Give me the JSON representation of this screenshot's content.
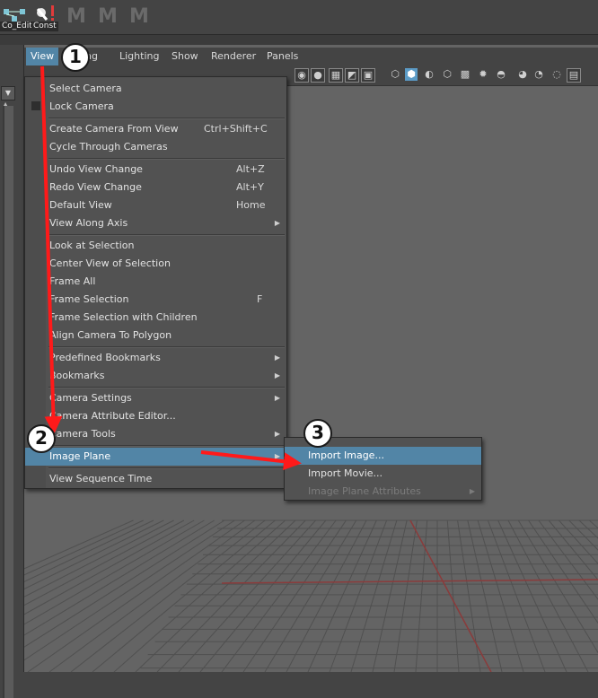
{
  "shelf": {
    "items": [
      {
        "label": "Co_Edit",
        "icon": "node-graph-icon"
      },
      {
        "label": "Const",
        "icon": "constraint-icon"
      }
    ],
    "m_icons": [
      "M",
      "M",
      "M"
    ]
  },
  "panel_menubar": {
    "items": [
      "View",
      "Shading",
      "Lighting",
      "Show",
      "Renderer",
      "Panels"
    ],
    "visible_labels": [
      "View",
      "ing",
      "Lighting",
      "Show",
      "Renderer",
      "Panels"
    ],
    "active": "View"
  },
  "view_menu": {
    "items": [
      {
        "label": "Select Camera",
        "shortcut": "",
        "submenu": false
      },
      {
        "label": "Lock Camera",
        "shortcut": "",
        "submenu": false
      },
      {
        "label": "Create Camera From View",
        "shortcut": "Ctrl+Shift+C",
        "submenu": false
      },
      {
        "label": "Cycle Through Cameras",
        "shortcut": "",
        "submenu": false
      },
      {
        "label": "Undo View Change",
        "shortcut": "Alt+Z",
        "submenu": false
      },
      {
        "label": "Redo View Change",
        "shortcut": "Alt+Y",
        "submenu": false
      },
      {
        "label": "Default View",
        "shortcut": "Home",
        "submenu": false
      },
      {
        "label": "View Along Axis",
        "shortcut": "",
        "submenu": true
      },
      {
        "label": "Look at Selection",
        "shortcut": "",
        "submenu": false
      },
      {
        "label": "Center View of Selection",
        "shortcut": "",
        "submenu": false
      },
      {
        "label": "Frame All",
        "shortcut": "",
        "submenu": false
      },
      {
        "label": "Frame Selection",
        "shortcut": "F",
        "submenu": false
      },
      {
        "label": "Frame Selection with Children",
        "shortcut": "",
        "submenu": false
      },
      {
        "label": "Align Camera To Polygon",
        "shortcut": "",
        "submenu": false
      },
      {
        "label": "Predefined Bookmarks",
        "shortcut": "",
        "submenu": true
      },
      {
        "label": "Bookmarks",
        "shortcut": "",
        "submenu": true
      },
      {
        "label": "Camera Settings",
        "shortcut": "",
        "submenu": true
      },
      {
        "label": "Camera Attribute Editor...",
        "shortcut": "",
        "submenu": false
      },
      {
        "label": "Camera Tools",
        "shortcut": "",
        "submenu": true
      },
      {
        "label": "Image Plane",
        "shortcut": "",
        "submenu": true,
        "highlighted": true
      },
      {
        "label": "View Sequence Time",
        "shortcut": "",
        "submenu": false
      }
    ]
  },
  "image_plane_submenu": {
    "items": [
      {
        "label": "Import Image...",
        "highlighted": true,
        "disabled": false,
        "submenu": false
      },
      {
        "label": "Import Movie...",
        "highlighted": false,
        "disabled": false,
        "submenu": false
      },
      {
        "label": "Image Plane Attributes",
        "highlighted": false,
        "disabled": true,
        "submenu": true
      }
    ]
  },
  "annotations": {
    "badges": [
      "1",
      "2",
      "3"
    ],
    "arrow_color": "#ff1a1a"
  },
  "colors": {
    "highlight": "#5285a6",
    "menu_bg": "#525252",
    "viewport_bg": "#646464",
    "grid_line": "#505050",
    "grid_axis": "#8a3b3b"
  }
}
